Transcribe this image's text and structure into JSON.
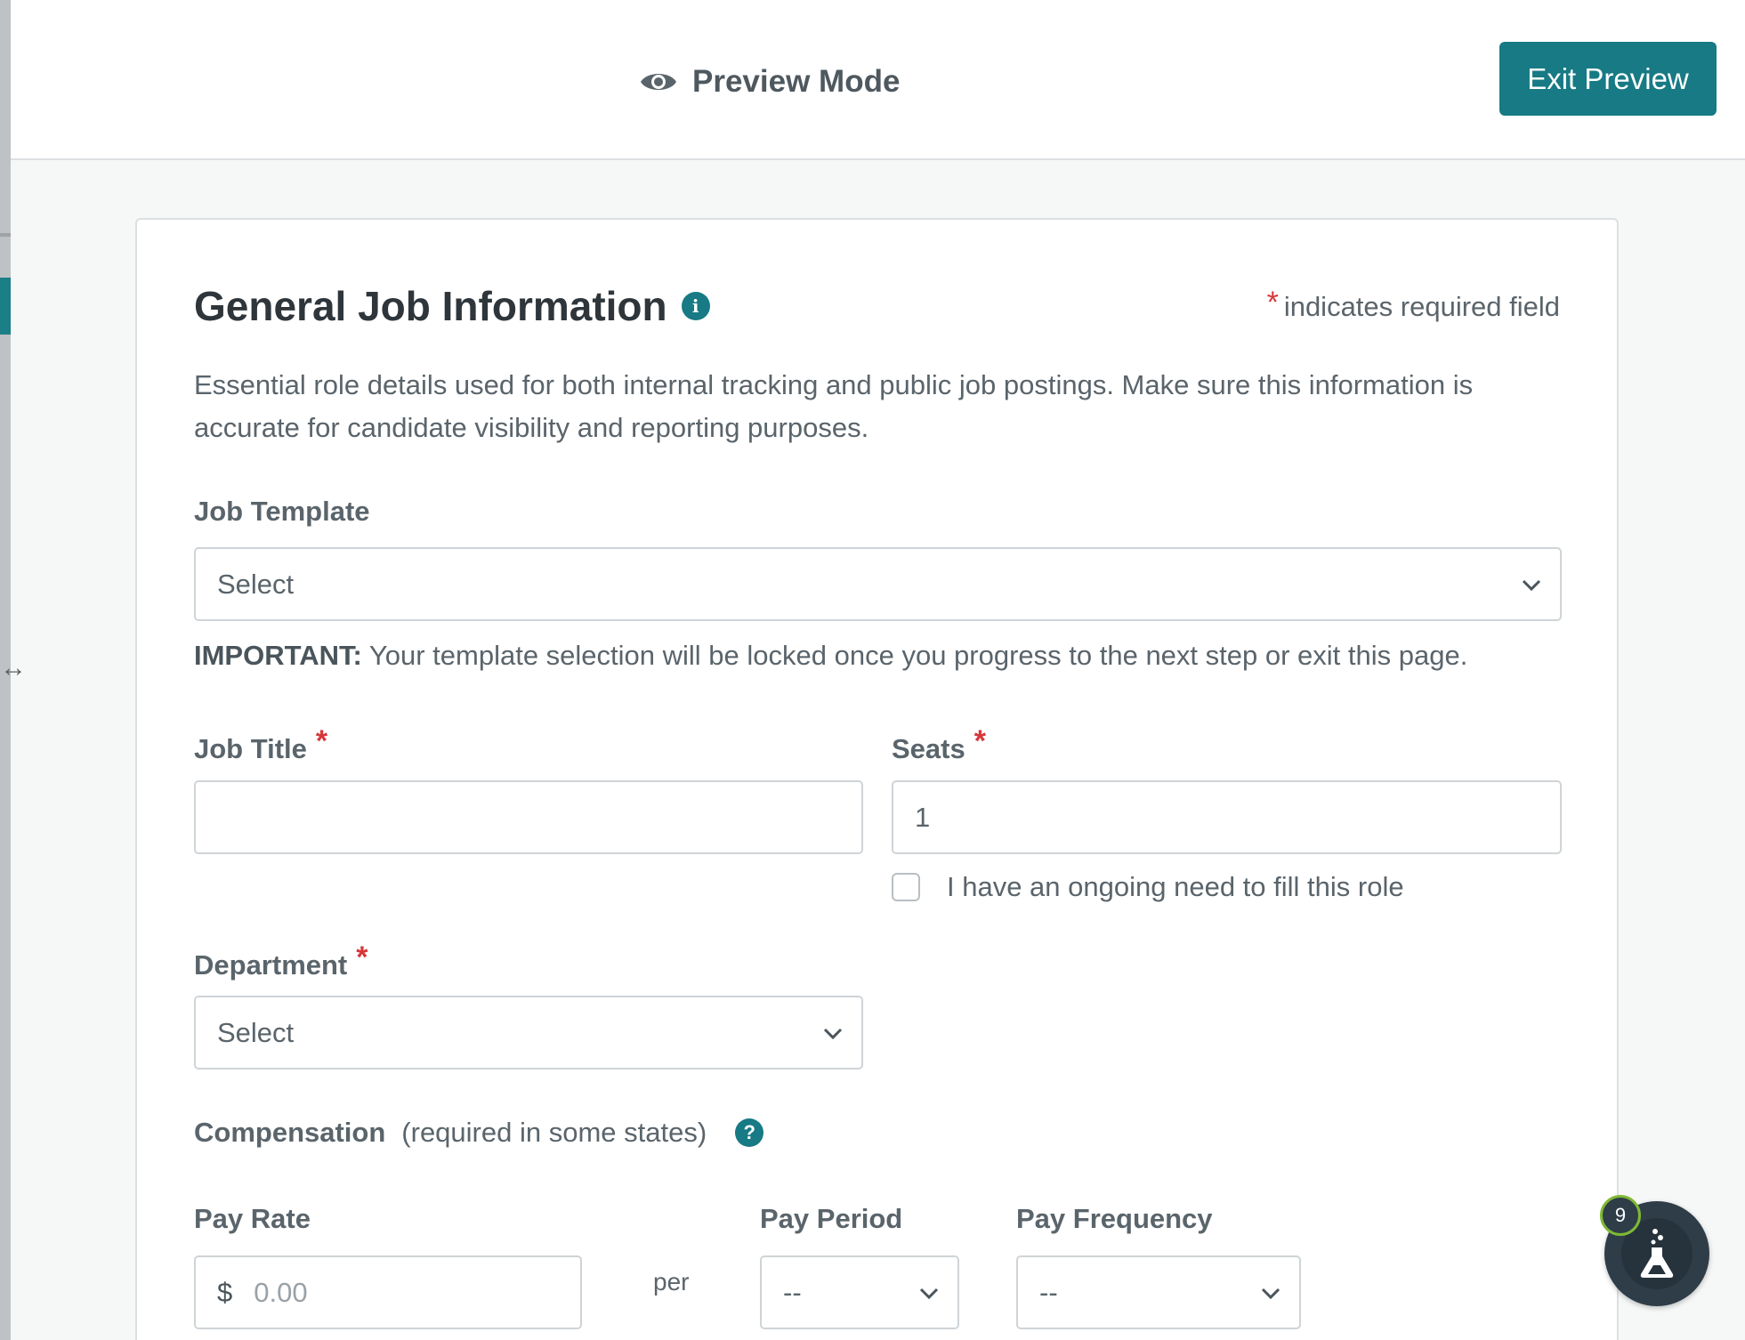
{
  "preview_bar": {
    "mode_label": "Preview Mode",
    "exit_button": "Exit Preview"
  },
  "card": {
    "title": "General Job Information",
    "required_note": "indicates required field",
    "required_marker": "*",
    "description": "Essential role details used for both internal tracking and public job postings. Make sure this information is accurate for candidate visibility and reporting purposes."
  },
  "job_template": {
    "label": "Job Template",
    "value": "Select"
  },
  "important": {
    "prefix": "IMPORTANT:",
    "text": " Your template selection will be locked once you progress to the next step or exit this page."
  },
  "job_title": {
    "label": "Job Title",
    "value": ""
  },
  "seats": {
    "label": "Seats",
    "value": "1",
    "ongoing_label": "I have an ongoing need to fill this role",
    "ongoing_checked": false
  },
  "department": {
    "label": "Department",
    "value": "Select"
  },
  "compensation": {
    "label": "Compensation",
    "note": "(required in some states)",
    "help_glyph": "?"
  },
  "pay_rate": {
    "label": "Pay Rate",
    "currency": "$",
    "placeholder": "0.00",
    "per": "per"
  },
  "pay_period": {
    "label": "Pay Period",
    "value": "--"
  },
  "pay_frequency": {
    "label": "Pay Frequency",
    "value": "--"
  },
  "widget": {
    "badge_count": "9"
  },
  "icons": {
    "info": "i",
    "resize": "↔"
  },
  "colors": {
    "accent": "#177a84",
    "required": "#d6373a",
    "badge_ring": "#7fb935"
  }
}
